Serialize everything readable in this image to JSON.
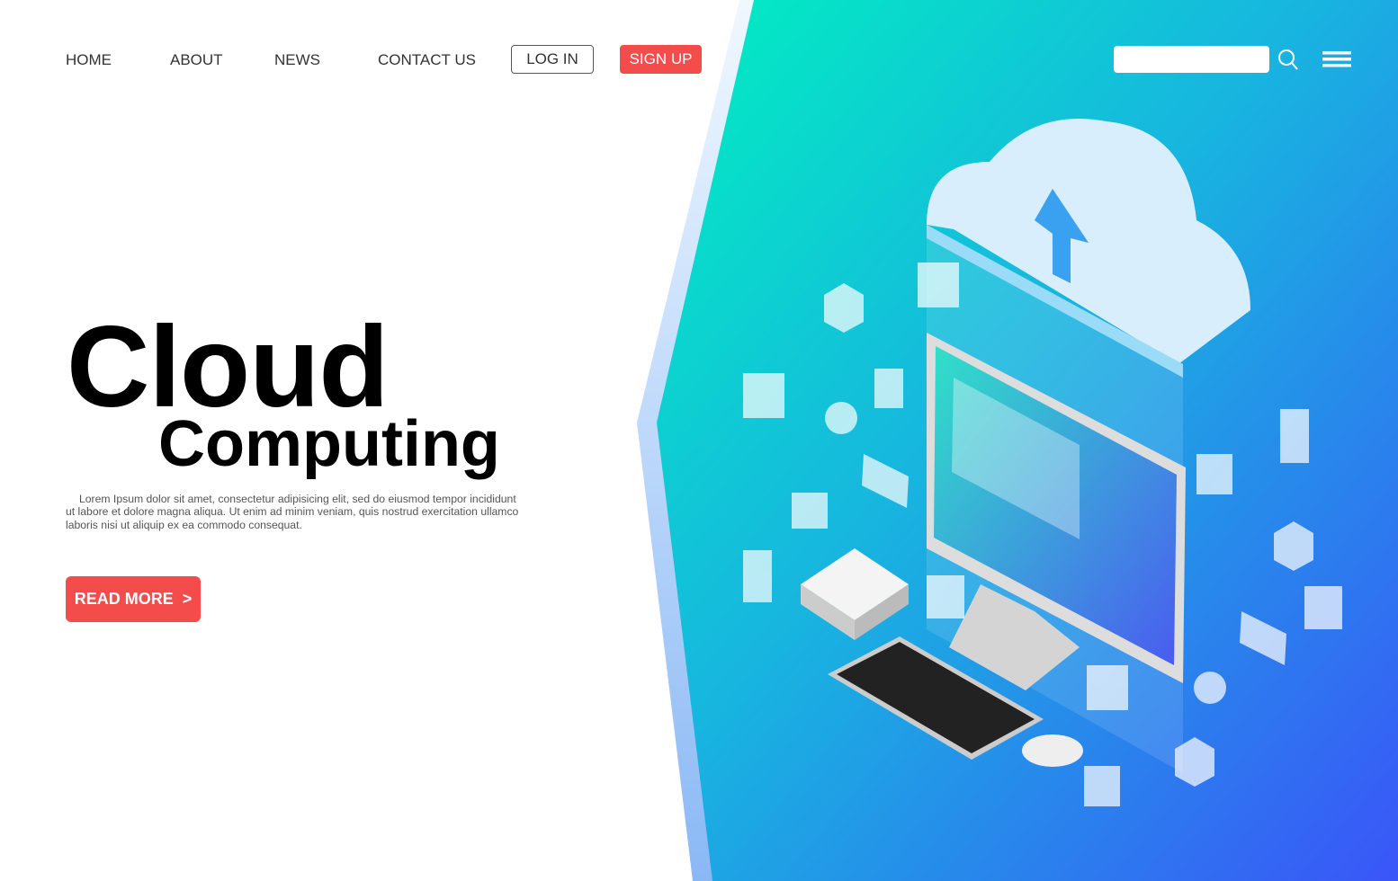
{
  "nav": {
    "items": [
      "HOME",
      "ABOUT",
      "NEWS",
      "CONTACT US"
    ],
    "login": "LOG IN",
    "signup": "SIGN UP"
  },
  "search": {
    "placeholder": "",
    "value": ""
  },
  "hero": {
    "title": "Cloud",
    "subtitle": "Computing",
    "description": "Lorem Ipsum dolor sit amet, consectetur adipisicing elit, sed do eiusmod tempor incididunt ut labore et dolore magna aliqua. Ut enim ad minim veniam, quis nostrud exercitation ullamco laboris nisi ut aliquip ex ea commodo consequat.",
    "cta": "READ MORE",
    "cta_arrow": ">"
  },
  "colors": {
    "accent": "#f44b4b",
    "gradient_start": "#00f0c0",
    "gradient_end": "#3a55f8"
  },
  "icons": [
    "search-icon",
    "hamburger-menu-icon",
    "cloud-upload-icon",
    "monitor-icon",
    "keyboard-icon",
    "mouse-icon",
    "server-icon",
    "folder-icon",
    "lock-icon",
    "music-icon",
    "image-icon",
    "video-icon",
    "mail-icon",
    "document-icon"
  ]
}
